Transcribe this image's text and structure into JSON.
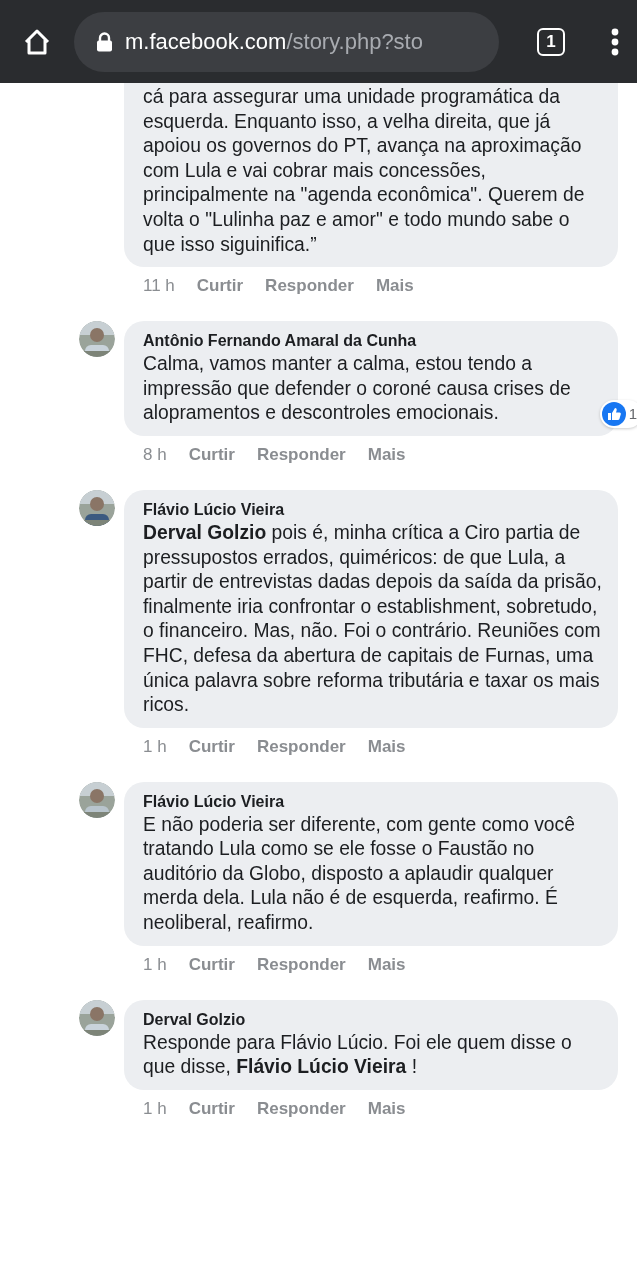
{
  "browser": {
    "url_host": "m.facebook.com",
    "url_path": "/story.php?sto",
    "tab_count": "1"
  },
  "comments": [
    {
      "text": "cá para assegurar uma unidade programática da esquerda. Enquanto isso, a velha direita, que já apoiou os governos do PT, avança na aproximação com Lula e vai cobrar mais concessões, principalmente na \"agenda econômica\". Querem de volta o \"Lulinha paz e amor\" e todo mundo sabe o que isso siguinifica.”",
      "time": "11 h",
      "actions": [
        "Curtir",
        "Responder",
        "Mais"
      ]
    },
    {
      "author": "Antônio Fernando Amaral da Cunha",
      "text": "Calma, vamos manter a calma, estou tendo a impressão que defender o coroné causa crises de alopramentos e descontroles emocionais.",
      "reaction_count": "1",
      "time": "8 h",
      "actions": [
        "Curtir",
        "Responder",
        "Mais"
      ]
    },
    {
      "author": "Flávio Lúcio Vieira",
      "text": "**Derval Golzio** pois é, minha crítica a Ciro partia de pressupostos errados, quiméricos: de que Lula, a partir de entrevistas dadas depois da saída da prisão, finalmente iria confrontar o establishment, sobretudo, o financeiro. Mas, não. Foi o contrário. Reuniões com FHC, defesa da abertura de capitais de Furnas, uma única palavra sobre reforma tributária e taxar os mais ricos.",
      "time": "1 h",
      "actions": [
        "Curtir",
        "Responder",
        "Mais"
      ]
    },
    {
      "author": "Flávio Lúcio Vieira",
      "text": "E não poderia ser diferente, com gente como você tratando Lula como se ele fosse o Faustão no auditório da Globo, disposto a aplaudir qualquer merda dela. Lula não é de esquerda, reafirmo. É neoliberal, reafirmo.",
      "time": "1 h",
      "actions": [
        "Curtir",
        "Responder",
        "Mais"
      ]
    },
    {
      "author": "Derval Golzio",
      "text": "Responde para Flávio Lúcio. Foi ele quem disse o que disse, **Flávio Lúcio Vieira** !",
      "time": "1 h",
      "actions": [
        "Curtir",
        "Responder",
        "Mais"
      ]
    }
  ]
}
